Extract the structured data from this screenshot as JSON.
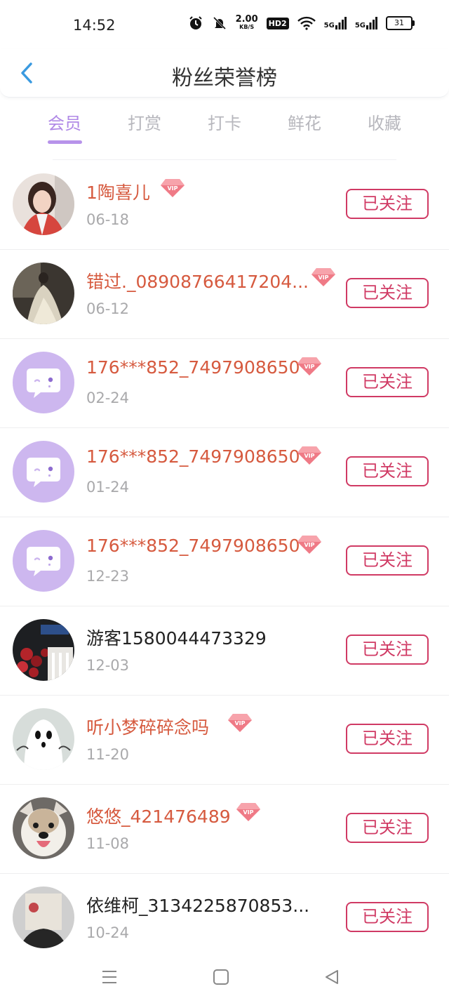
{
  "status_bar": {
    "time": "14:52",
    "net_speed_value": "2.00",
    "net_speed_unit": "KB/S",
    "hd_label": "HD2",
    "signal1_label": "5G",
    "signal2_label": "5G",
    "battery": "31"
  },
  "header": {
    "title": "粉丝荣誉榜",
    "back_icon": "chevron-left-icon"
  },
  "tabs": [
    {
      "label": "会员",
      "active": true
    },
    {
      "label": "打赏",
      "active": false
    },
    {
      "label": "打卡",
      "active": false
    },
    {
      "label": "鲜花",
      "active": false
    },
    {
      "label": "收藏",
      "active": false
    }
  ],
  "colors": {
    "accent_purple": "#b089e6",
    "vip_name": "#d65a3f",
    "follow_border": "#d03a64",
    "avatar_default_bg": "#cdb7ef"
  },
  "follow_label": "已关注",
  "fans": [
    {
      "name": "1陶喜儿",
      "date": "06-18",
      "vip": true,
      "avatar": "photo-girl-red"
    },
    {
      "name": "错过._08908766417204...",
      "date": "06-12",
      "vip": true,
      "avatar": "photo-dress"
    },
    {
      "name": "176***852_7497908650",
      "date": "02-24",
      "vip": true,
      "avatar": "default-chat-avatar"
    },
    {
      "name": "176***852_7497908650",
      "date": "01-24",
      "vip": true,
      "avatar": "default-chat-avatar"
    },
    {
      "name": "176***852_7497908650",
      "date": "12-23",
      "vip": true,
      "avatar": "default-chat-avatar"
    },
    {
      "name": "游客1580044473329",
      "date": "12-03",
      "vip": false,
      "avatar": "photo-roses"
    },
    {
      "name": "听小梦碎碎念吗",
      "date": "11-20",
      "vip": true,
      "avatar": "photo-ghost"
    },
    {
      "name": "悠悠_421476489",
      "date": "11-08",
      "vip": true,
      "avatar": "photo-dog"
    },
    {
      "name": "依维柯_3134225870853...",
      "date": "10-24",
      "vip": false,
      "avatar": "photo-box-head"
    }
  ],
  "vip_label": "VIP",
  "nav": [
    "menu-icon",
    "home-square-icon",
    "back-triangle-icon"
  ]
}
